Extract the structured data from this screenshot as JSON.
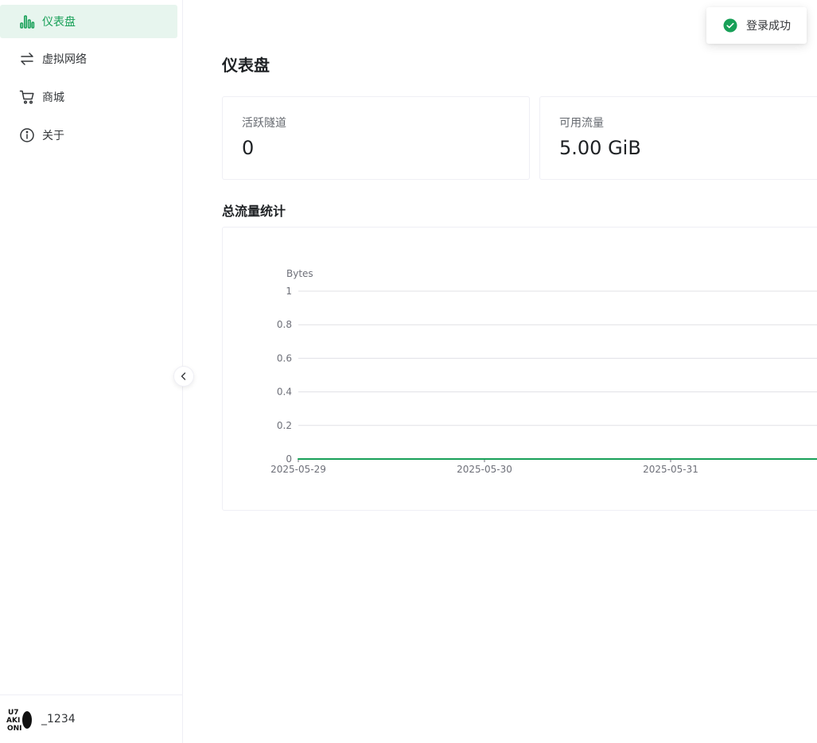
{
  "sidebar": {
    "items": [
      {
        "label": "仪表盘",
        "icon": "bar-chart-icon",
        "active": true
      },
      {
        "label": "虚拟网络",
        "icon": "swap-arrows-icon",
        "active": false
      },
      {
        "label": "商城",
        "icon": "cart-icon",
        "active": false
      },
      {
        "label": "关于",
        "icon": "info-icon",
        "active": false
      }
    ],
    "user": {
      "name": "_1234",
      "avatar_text": "U7 AKI ONI"
    }
  },
  "main": {
    "title": "仪表盘",
    "stats": [
      {
        "label": "活跃隧道",
        "value": "0"
      },
      {
        "label": "可用流量",
        "value": "5.00 GiB"
      }
    ],
    "traffic_section_title": "总流量统计"
  },
  "toast": {
    "text": "登录成功",
    "icon": "check-circle-icon"
  },
  "colors": {
    "accent": "#18a058",
    "grid": "#e0e0e6",
    "axis_text": "#6e7079"
  },
  "chart_data": {
    "type": "line",
    "ylabel": "Bytes",
    "x": [
      "2025-05-29",
      "2025-05-30",
      "2025-05-31"
    ],
    "series": [
      {
        "values": [
          0,
          0,
          0
        ]
      }
    ],
    "ylim": [
      0,
      1
    ],
    "yticks": [
      0,
      0.2,
      0.4,
      0.6,
      0.8,
      1
    ],
    "grid": true
  }
}
